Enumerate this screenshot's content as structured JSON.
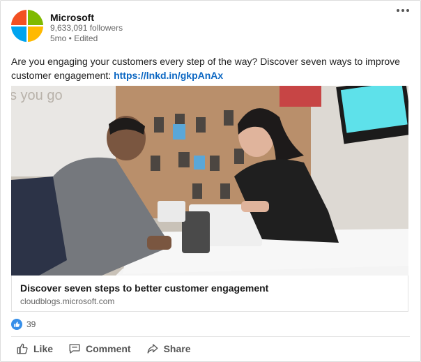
{
  "post": {
    "company": "Microsoft",
    "followers": "9,633,091 followers",
    "time": "5mo • Edited",
    "text": "Are you engaging your customers every step of the way? Discover seven ways to improve customer engagement: ",
    "link": "https://lnkd.in/gkpAnAx",
    "image_sign_text": "s you go"
  },
  "preview": {
    "title": "Discover seven steps to better customer engagement",
    "domain": "cloudblogs.microsoft.com"
  },
  "reactions": {
    "count": "39"
  },
  "actions": {
    "like": "Like",
    "comment": "Comment",
    "share": "Share"
  },
  "icons": {
    "logo": "microsoft-logo",
    "more": "ellipsis-icon",
    "like": "thumbs-up-icon",
    "comment": "comment-icon",
    "share": "share-icon",
    "reaction": "like-reaction-icon"
  },
  "colors": {
    "link": "#0a66c2",
    "logo_red": "#f25022",
    "logo_green": "#7fba00",
    "logo_blue": "#00a4ef",
    "logo_yellow": "#ffb900"
  }
}
